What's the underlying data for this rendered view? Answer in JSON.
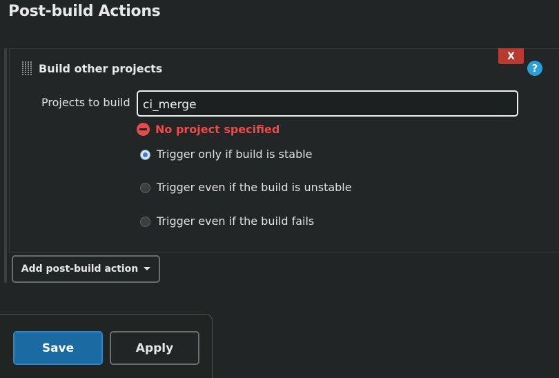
{
  "section": {
    "title": "Post-build Actions"
  },
  "step": {
    "title": "Build other projects",
    "delete_label": "X",
    "help_label": "?",
    "field_label": "Projects to build",
    "projects_value": "ci_merge",
    "error_text": "No project specified",
    "options": [
      {
        "label": "Trigger only if build is stable",
        "checked": true
      },
      {
        "label": "Trigger even if the build is unstable",
        "checked": false
      },
      {
        "label": "Trigger even if the build fails",
        "checked": false
      }
    ]
  },
  "actions": {
    "add_post_build_label": "Add post-build action"
  },
  "footer": {
    "save_label": "Save",
    "apply_label": "Apply"
  },
  "colors": {
    "background": "#222526",
    "error": "#f04a4a",
    "delete": "#b83a30",
    "help": "#2a9fd8",
    "primary": "#1b6aa2"
  }
}
